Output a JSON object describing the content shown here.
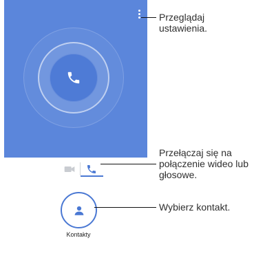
{
  "screen": {
    "contacts_label": "Kontakty",
    "icons": {
      "menu": "more-vert-icon",
      "call": "phone-icon",
      "video": "videocam-icon",
      "voice": "phone-icon",
      "contacts": "person-icon"
    },
    "colors": {
      "panel": "#5b86db",
      "accent": "#4a78d3"
    }
  },
  "callouts": {
    "settings": [
      "Przeglądaj",
      "ustawienia."
    ],
    "mode": [
      "Przełączaj się na",
      "połączenie wideo lub",
      "głosowe."
    ],
    "contact": [
      "Wybierz kontakt."
    ]
  }
}
